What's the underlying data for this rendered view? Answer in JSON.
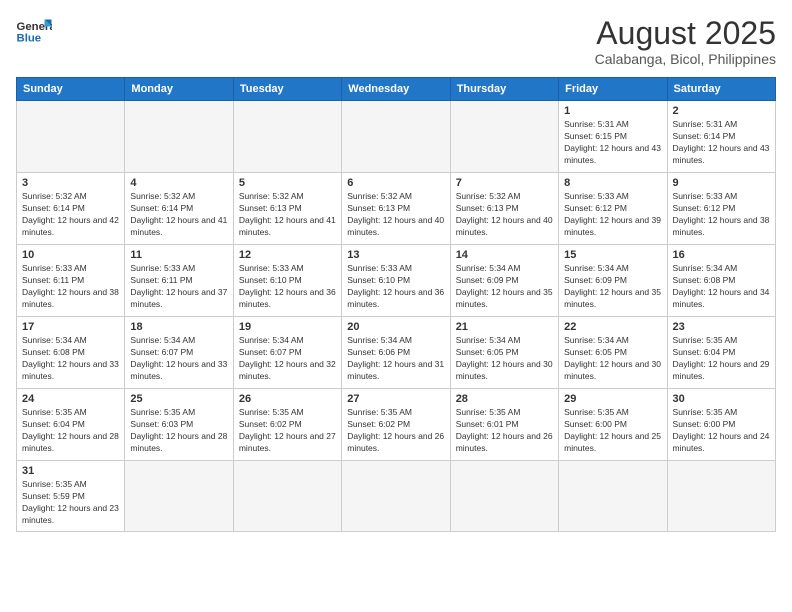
{
  "header": {
    "logo_general": "General",
    "logo_blue": "Blue",
    "title": "August 2025",
    "subtitle": "Calabanga, Bicol, Philippines"
  },
  "days_of_week": [
    "Sunday",
    "Monday",
    "Tuesday",
    "Wednesday",
    "Thursday",
    "Friday",
    "Saturday"
  ],
  "weeks": [
    [
      {
        "day": "",
        "info": ""
      },
      {
        "day": "",
        "info": ""
      },
      {
        "day": "",
        "info": ""
      },
      {
        "day": "",
        "info": ""
      },
      {
        "day": "",
        "info": ""
      },
      {
        "day": "1",
        "info": "Sunrise: 5:31 AM\nSunset: 6:15 PM\nDaylight: 12 hours and 43 minutes."
      },
      {
        "day": "2",
        "info": "Sunrise: 5:31 AM\nSunset: 6:14 PM\nDaylight: 12 hours and 43 minutes."
      }
    ],
    [
      {
        "day": "3",
        "info": "Sunrise: 5:32 AM\nSunset: 6:14 PM\nDaylight: 12 hours and 42 minutes."
      },
      {
        "day": "4",
        "info": "Sunrise: 5:32 AM\nSunset: 6:14 PM\nDaylight: 12 hours and 41 minutes."
      },
      {
        "day": "5",
        "info": "Sunrise: 5:32 AM\nSunset: 6:13 PM\nDaylight: 12 hours and 41 minutes."
      },
      {
        "day": "6",
        "info": "Sunrise: 5:32 AM\nSunset: 6:13 PM\nDaylight: 12 hours and 40 minutes."
      },
      {
        "day": "7",
        "info": "Sunrise: 5:32 AM\nSunset: 6:13 PM\nDaylight: 12 hours and 40 minutes."
      },
      {
        "day": "8",
        "info": "Sunrise: 5:33 AM\nSunset: 6:12 PM\nDaylight: 12 hours and 39 minutes."
      },
      {
        "day": "9",
        "info": "Sunrise: 5:33 AM\nSunset: 6:12 PM\nDaylight: 12 hours and 38 minutes."
      }
    ],
    [
      {
        "day": "10",
        "info": "Sunrise: 5:33 AM\nSunset: 6:11 PM\nDaylight: 12 hours and 38 minutes."
      },
      {
        "day": "11",
        "info": "Sunrise: 5:33 AM\nSunset: 6:11 PM\nDaylight: 12 hours and 37 minutes."
      },
      {
        "day": "12",
        "info": "Sunrise: 5:33 AM\nSunset: 6:10 PM\nDaylight: 12 hours and 36 minutes."
      },
      {
        "day": "13",
        "info": "Sunrise: 5:33 AM\nSunset: 6:10 PM\nDaylight: 12 hours and 36 minutes."
      },
      {
        "day": "14",
        "info": "Sunrise: 5:34 AM\nSunset: 6:09 PM\nDaylight: 12 hours and 35 minutes."
      },
      {
        "day": "15",
        "info": "Sunrise: 5:34 AM\nSunset: 6:09 PM\nDaylight: 12 hours and 35 minutes."
      },
      {
        "day": "16",
        "info": "Sunrise: 5:34 AM\nSunset: 6:08 PM\nDaylight: 12 hours and 34 minutes."
      }
    ],
    [
      {
        "day": "17",
        "info": "Sunrise: 5:34 AM\nSunset: 6:08 PM\nDaylight: 12 hours and 33 minutes."
      },
      {
        "day": "18",
        "info": "Sunrise: 5:34 AM\nSunset: 6:07 PM\nDaylight: 12 hours and 33 minutes."
      },
      {
        "day": "19",
        "info": "Sunrise: 5:34 AM\nSunset: 6:07 PM\nDaylight: 12 hours and 32 minutes."
      },
      {
        "day": "20",
        "info": "Sunrise: 5:34 AM\nSunset: 6:06 PM\nDaylight: 12 hours and 31 minutes."
      },
      {
        "day": "21",
        "info": "Sunrise: 5:34 AM\nSunset: 6:05 PM\nDaylight: 12 hours and 30 minutes."
      },
      {
        "day": "22",
        "info": "Sunrise: 5:34 AM\nSunset: 6:05 PM\nDaylight: 12 hours and 30 minutes."
      },
      {
        "day": "23",
        "info": "Sunrise: 5:35 AM\nSunset: 6:04 PM\nDaylight: 12 hours and 29 minutes."
      }
    ],
    [
      {
        "day": "24",
        "info": "Sunrise: 5:35 AM\nSunset: 6:04 PM\nDaylight: 12 hours and 28 minutes."
      },
      {
        "day": "25",
        "info": "Sunrise: 5:35 AM\nSunset: 6:03 PM\nDaylight: 12 hours and 28 minutes."
      },
      {
        "day": "26",
        "info": "Sunrise: 5:35 AM\nSunset: 6:02 PM\nDaylight: 12 hours and 27 minutes."
      },
      {
        "day": "27",
        "info": "Sunrise: 5:35 AM\nSunset: 6:02 PM\nDaylight: 12 hours and 26 minutes."
      },
      {
        "day": "28",
        "info": "Sunrise: 5:35 AM\nSunset: 6:01 PM\nDaylight: 12 hours and 26 minutes."
      },
      {
        "day": "29",
        "info": "Sunrise: 5:35 AM\nSunset: 6:00 PM\nDaylight: 12 hours and 25 minutes."
      },
      {
        "day": "30",
        "info": "Sunrise: 5:35 AM\nSunset: 6:00 PM\nDaylight: 12 hours and 24 minutes."
      }
    ],
    [
      {
        "day": "31",
        "info": "Sunrise: 5:35 AM\nSunset: 5:59 PM\nDaylight: 12 hours and 23 minutes."
      },
      {
        "day": "",
        "info": ""
      },
      {
        "day": "",
        "info": ""
      },
      {
        "day": "",
        "info": ""
      },
      {
        "day": "",
        "info": ""
      },
      {
        "day": "",
        "info": ""
      },
      {
        "day": "",
        "info": ""
      }
    ]
  ]
}
